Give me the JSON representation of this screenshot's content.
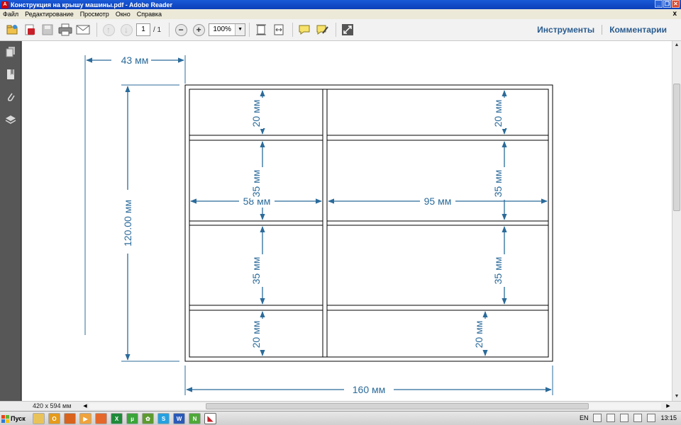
{
  "window": {
    "title": "Конструкция на крышу машины.pdf - Adobe Reader",
    "app_icon_letter": "A",
    "controls": [
      "minimize-icon",
      "restore-icon",
      "close-icon"
    ]
  },
  "menu": {
    "items": [
      "Файл",
      "Редактирование",
      "Просмотр",
      "Окно",
      "Справка"
    ],
    "doc_close": "x"
  },
  "toolbar": {
    "page_current": "1",
    "page_total": "/ 1",
    "zoom": "100%",
    "zoom_dropdown": "▼",
    "tools_label": "Инструменты",
    "comments_label": "Комментарии"
  },
  "drawing": {
    "dimensions": {
      "top_offset": "43 мм",
      "total_height": "120.00 мм",
      "total_width": "160 мм",
      "left_width": "58 мм",
      "right_width": "95 мм",
      "left_row1": "20 мм",
      "left_row2": "35 мм",
      "left_row3": "35 мм",
      "left_row4": "20 мм",
      "right_row1": "20 мм",
      "right_row2": "35 мм",
      "right_row3": "35 мм",
      "right_row4": "20 мм"
    },
    "colors": {
      "dimension": "#2b6b9a",
      "outline": "#000000"
    }
  },
  "status": {
    "page_size": "420 x 594 мм"
  },
  "taskbar": {
    "start_label": "Пуск",
    "language": "EN",
    "clock": "13:15",
    "quick_launch": [
      "explorer-icon",
      "outlook-icon",
      "firefox-icon",
      "media-player-icon",
      "firefox-alt-icon",
      "excel-icon",
      "utorrent-icon",
      "settings-icon",
      "skype-icon",
      "word-icon",
      "notepad-icon",
      "adobe-reader-icon"
    ]
  }
}
